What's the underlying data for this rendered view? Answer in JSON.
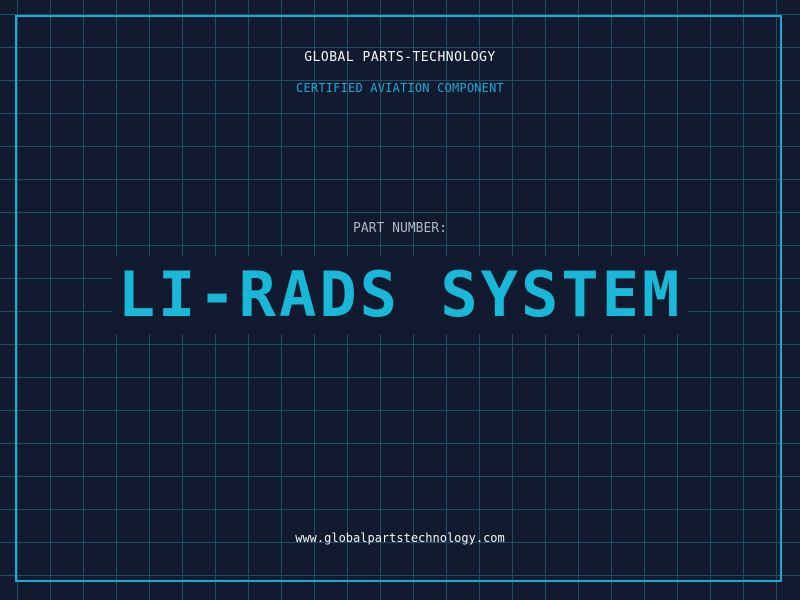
{
  "header": {
    "brand": "GLOBAL PARTS-TECHNOLOGY",
    "subtitle": "CERTIFIED AVIATION COMPONENT"
  },
  "part": {
    "label": "PART NUMBER:",
    "value": "LI-RADS SYSTEM"
  },
  "footer": {
    "website": "www.globalpartstechnology.com"
  },
  "colors": {
    "background": "#111a2e",
    "grid": "#1f4f63",
    "accent": "#1ba9d6",
    "text": "#f2f5fa"
  }
}
